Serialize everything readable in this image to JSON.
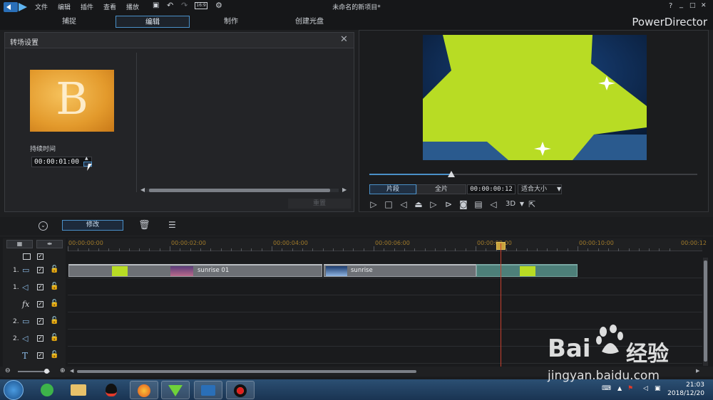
{
  "app": {
    "project_title": "未命名的新项目*",
    "brand": "PowerDirector",
    "menu": [
      "文件",
      "编辑",
      "插件",
      "查看",
      "播放"
    ],
    "window_controls": [
      "?",
      "_",
      "□",
      "✕"
    ]
  },
  "tabs": [
    {
      "label": "捕捉",
      "active": false
    },
    {
      "label": "编辑",
      "active": true
    },
    {
      "label": "制作",
      "active": false
    },
    {
      "label": "创建光盘",
      "active": false
    }
  ],
  "transition_panel": {
    "title": "转场设置",
    "thumb_letter": "B",
    "duration_label": "持续时间",
    "duration_value": "00:00:01:00",
    "reset_label": "重置"
  },
  "preview": {
    "segment_label": "片段",
    "full_label": "全片",
    "timecode": "00:00:00:12",
    "fit_label": "适合大小",
    "progress": 0.25,
    "mode_3d": "3D"
  },
  "toolbar": {
    "modify_label": "修改"
  },
  "timeline": {
    "ruler_labels": [
      "00:00:00:00",
      "00:00:02:00",
      "00:00:04:00",
      "00:00:06:00",
      "00:00:08:00",
      "00:00:10:00",
      "00:00:12"
    ],
    "rows": [
      {
        "num": "1.",
        "type": "video"
      },
      {
        "num": "1.",
        "type": "audio"
      },
      {
        "num": "",
        "type": "fx"
      },
      {
        "num": "2.",
        "type": "video"
      },
      {
        "num": "2.",
        "type": "audio"
      },
      {
        "num": "",
        "type": "title"
      }
    ],
    "clips": [
      {
        "name": "sunrise 01"
      },
      {
        "name": "sunrise"
      }
    ]
  },
  "taskbar": {
    "time": "21:03",
    "date": "2018/12/20"
  },
  "watermark": {
    "text1": "Bai",
    "text2": "经验",
    "url": "jingyan.baidu.com"
  },
  "colors": {
    "accent": "#4a90c8",
    "playhead": "#c8402e",
    "preview_shape": "#b8dc24"
  }
}
